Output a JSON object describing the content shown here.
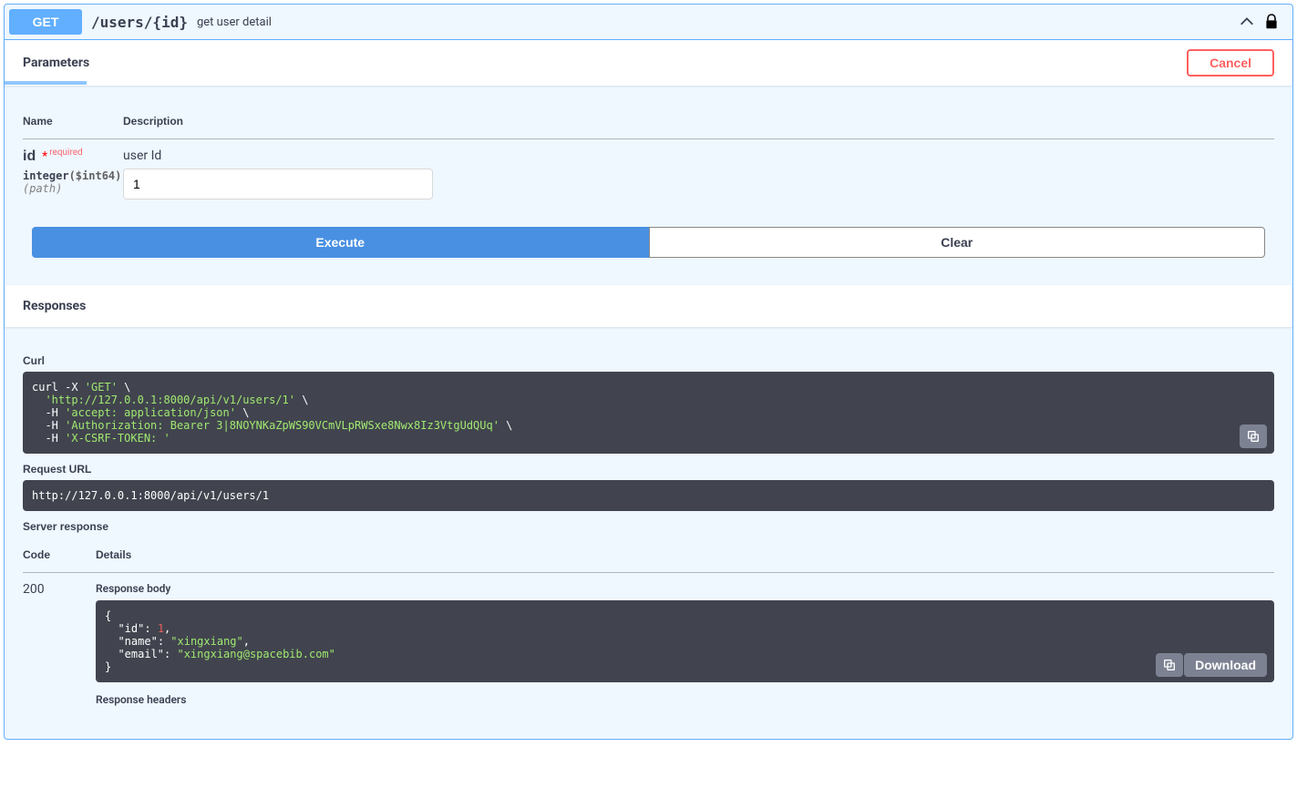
{
  "summary": {
    "method": "GET",
    "path": "/users/{id}",
    "description": "get user detail"
  },
  "parameters_section": {
    "tab_label": "Parameters",
    "cancel_label": "Cancel",
    "col_name": "Name",
    "col_desc": "Description"
  },
  "parameter": {
    "name": "id",
    "required_label": "required",
    "type": "integer",
    "format": "($int64)",
    "in": "(path)",
    "description": "user Id",
    "value": "1"
  },
  "actions": {
    "execute": "Execute",
    "clear": "Clear"
  },
  "responses_section": {
    "title": "Responses",
    "curl_label": "Curl",
    "request_url_label": "Request URL",
    "server_response_label": "Server response",
    "col_code": "Code",
    "col_details": "Details",
    "response_body_label": "Response body",
    "response_headers_label": "Response headers",
    "download_label": "Download"
  },
  "curl": {
    "prefix": "curl -X ",
    "method": "'GET'",
    "url": "'http://127.0.0.1:8000/api/v1/users/1'",
    "h1_k": "  -H ",
    "h1_v": "'accept: application/json'",
    "h2_v": "'Authorization: Bearer 3|8NOYNKaZpWS90VCmVLpRWSxe8Nwx8Iz3VtgUdQUq'",
    "h3_v": "'X-CSRF-TOKEN: '"
  },
  "request_url": "http://127.0.0.1:8000/api/v1/users/1",
  "response": {
    "code": "200",
    "body": {
      "id_key": "\"id\"",
      "id_val": "1",
      "name_key": "\"name\"",
      "name_val": "\"xingxiang\"",
      "email_key": "\"email\"",
      "email_val": "\"xingxiang@spacebib.com\""
    }
  }
}
